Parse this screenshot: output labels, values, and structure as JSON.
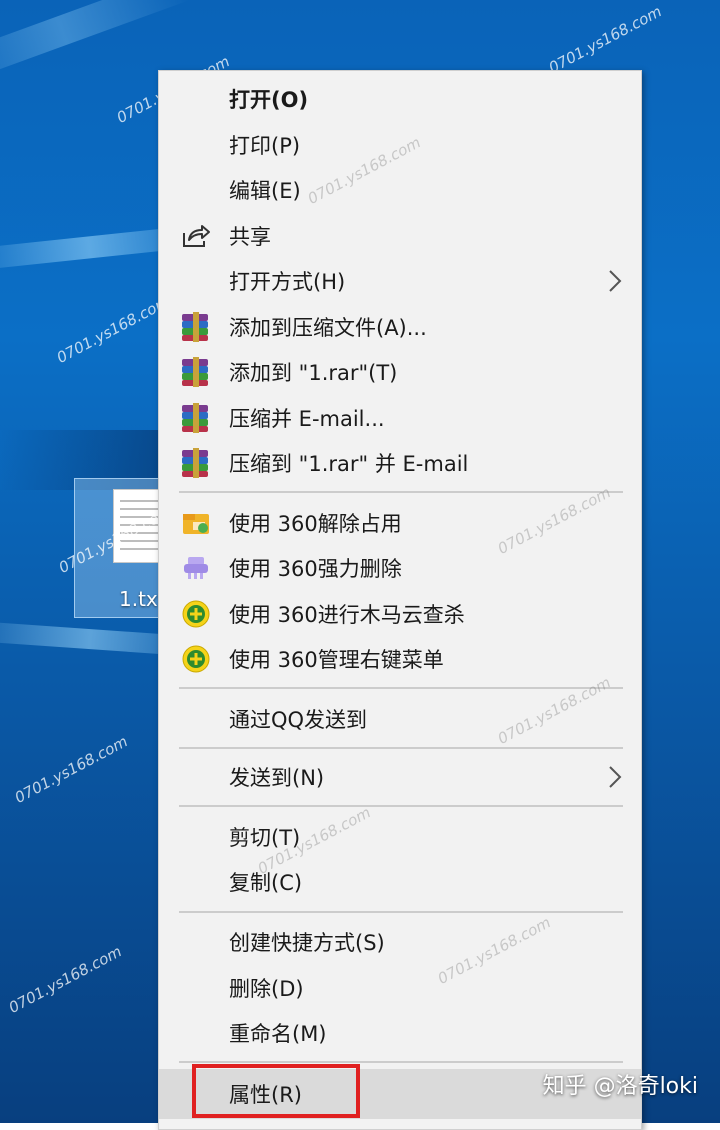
{
  "desktop": {
    "file_label": "1.txt",
    "file_icon": "text-file-icon"
  },
  "context_menu": {
    "items": [
      {
        "label": "打开(O)",
        "icon": "none",
        "bold": true
      },
      {
        "label": "打印(P)",
        "icon": "none"
      },
      {
        "label": "编辑(E)",
        "icon": "none"
      },
      {
        "label": "共享",
        "icon": "share-icon"
      },
      {
        "label": "打开方式(H)",
        "icon": "none",
        "submenu": true
      },
      {
        "label": "添加到压缩文件(A)...",
        "icon": "winrar-icon"
      },
      {
        "label": "添加到 \"1.rar\"(T)",
        "icon": "winrar-icon"
      },
      {
        "label": "压缩并 E-mail...",
        "icon": "winrar-icon"
      },
      {
        "label": "压缩到 \"1.rar\" 并 E-mail",
        "icon": "winrar-icon"
      },
      {
        "label": "使用 360解除占用",
        "icon": "360-unlock-icon"
      },
      {
        "label": "使用 360强力删除",
        "icon": "360-shred-icon"
      },
      {
        "label": "使用 360进行木马云查杀",
        "icon": "360-scan-icon"
      },
      {
        "label": "使用 360管理右键菜单",
        "icon": "360-scan-icon"
      },
      {
        "label": "通过QQ发送到",
        "icon": "none"
      },
      {
        "label": "发送到(N)",
        "icon": "none",
        "submenu": true
      },
      {
        "label": "剪切(T)",
        "icon": "none"
      },
      {
        "label": "复制(C)",
        "icon": "none"
      },
      {
        "label": "创建快捷方式(S)",
        "icon": "none"
      },
      {
        "label": "删除(D)",
        "icon": "none"
      },
      {
        "label": "重命名(M)",
        "icon": "none"
      },
      {
        "label": "属性(R)",
        "icon": "none",
        "hover": true
      }
    ]
  },
  "watermark_text": "0701.ys168.com",
  "footer_credit": "知乎 @洛奇loki",
  "colors": {
    "menu_bg": "#f2f2f2",
    "highlight_border": "#e02020",
    "desktop_blue": "#0a63b8"
  }
}
